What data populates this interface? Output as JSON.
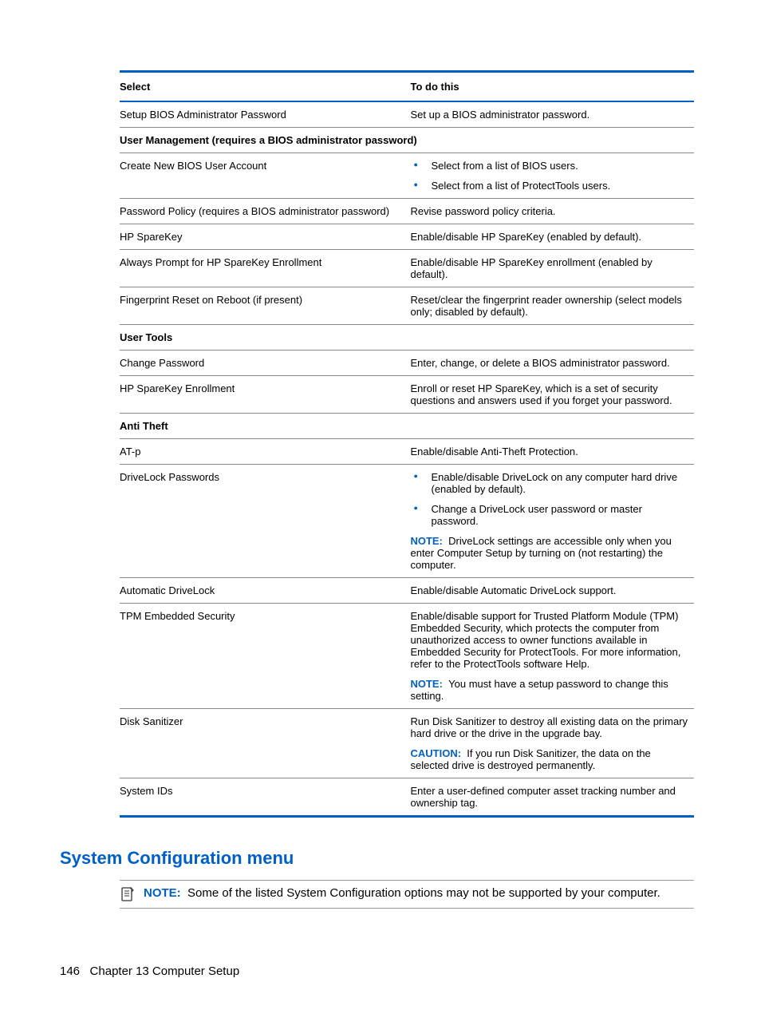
{
  "table": {
    "headers": {
      "select": "Select",
      "todo": "To do this"
    },
    "rows": {
      "setup_bios_admin": {
        "left": "Setup BIOS Administrator Password",
        "right": "Set up a BIOS administrator password."
      },
      "user_mgmt_header": "User Management (requires a BIOS administrator password)",
      "create_new_user": {
        "left": "Create New BIOS User Account",
        "bullets": [
          "Select from a list of BIOS users.",
          "Select from a list of ProtectTools users."
        ]
      },
      "pwd_policy": {
        "left": "Password Policy (requires a BIOS administrator password)",
        "right": "Revise password policy criteria."
      },
      "hp_sparekey": {
        "left": "HP SpareKey",
        "right": "Enable/disable HP SpareKey (enabled by default)."
      },
      "always_prompt": {
        "left": "Always Prompt for HP SpareKey Enrollment",
        "right": "Enable/disable HP SpareKey enrollment (enabled by default)."
      },
      "fingerprint": {
        "left": "Fingerprint Reset on Reboot (if present)",
        "right": "Reset/clear the fingerprint reader ownership (select models only; disabled by default)."
      },
      "user_tools_header": "User Tools",
      "change_pwd": {
        "left": "Change Password",
        "right": "Enter, change, or delete a BIOS administrator password."
      },
      "sparekey_enroll": {
        "left": "HP SpareKey Enrollment",
        "right": "Enroll or reset HP SpareKey, which is a set of security questions and answers used if you forget your password."
      },
      "anti_theft_header": "Anti Theft",
      "atp": {
        "left": "AT-p",
        "right": "Enable/disable Anti-Theft Protection."
      },
      "drivelock": {
        "left": "DriveLock Passwords",
        "bullets": [
          "Enable/disable DriveLock on any computer hard drive (enabled by default).",
          "Change a DriveLock user password or master password."
        ],
        "note_label": "NOTE:",
        "note_text": "DriveLock settings are accessible only when you enter Computer Setup by turning on (not restarting) the computer."
      },
      "auto_drivelock": {
        "left": "Automatic DriveLock",
        "right": "Enable/disable Automatic DriveLock support."
      },
      "tpm": {
        "left": "TPM Embedded Security",
        "right": "Enable/disable support for Trusted Platform Module (TPM) Embedded Security, which protects the computer from unauthorized access to owner functions available in Embedded Security for ProtectTools. For more information, refer to the ProtectTools software Help.",
        "note_label": "NOTE:",
        "note_text": "You must have a setup password to change this setting."
      },
      "disk_san": {
        "left": "Disk Sanitizer",
        "right": "Run Disk Sanitizer to destroy all existing data on the primary hard drive or the drive in the upgrade bay.",
        "caution_label": "CAUTION:",
        "caution_text": "If you run Disk Sanitizer, the data on the selected drive is destroyed permanently."
      },
      "system_ids": {
        "left": "System IDs",
        "right": "Enter a user-defined computer asset tracking number and ownership tag."
      }
    }
  },
  "heading": "System Configuration menu",
  "page_note": {
    "label": "NOTE:",
    "text": "Some of the listed System Configuration options may not be supported by your computer."
  },
  "footer": {
    "page": "146",
    "chapter": "Chapter 13   Computer Setup"
  }
}
